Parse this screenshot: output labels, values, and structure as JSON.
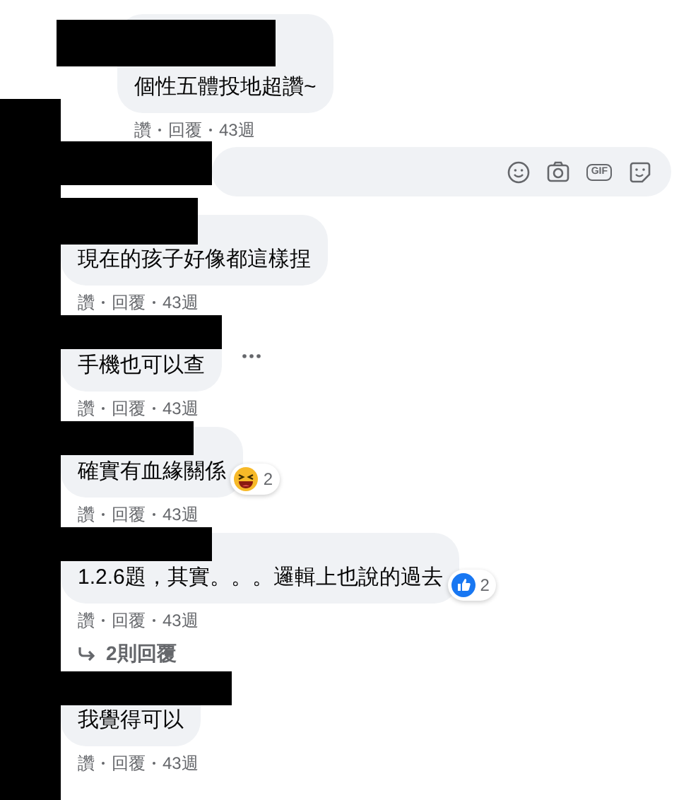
{
  "reply": {
    "text": "個性五體投地超讚~",
    "like": "讚",
    "reply": "回覆",
    "time": "43週"
  },
  "reply_composer": {
    "gif_label": "GIF"
  },
  "comments": [
    {
      "text": "現在的孩子好像都這樣捏",
      "like": "讚",
      "reply": "回覆",
      "time": "43週",
      "menu_visible": false
    },
    {
      "text": "手機也可以查",
      "like": "讚",
      "reply": "回覆",
      "time": "43週",
      "menu_visible": true
    },
    {
      "text": "確實有血緣關係",
      "like": "讚",
      "reply": "回覆",
      "time": "43週",
      "menu_visible": false,
      "reaction": {
        "kind": "haha",
        "count": "2"
      }
    },
    {
      "text": "1.2.6題，其實。。。邏輯上也說的過去",
      "like": "讚",
      "reply": "回覆",
      "time": "43週",
      "menu_visible": false,
      "reaction": {
        "kind": "like",
        "count": "2"
      },
      "replies_link": "2則回覆"
    },
    {
      "text": "我覺得可以",
      "like": "讚",
      "reply": "回覆",
      "time": "43週",
      "menu_visible": false
    }
  ]
}
